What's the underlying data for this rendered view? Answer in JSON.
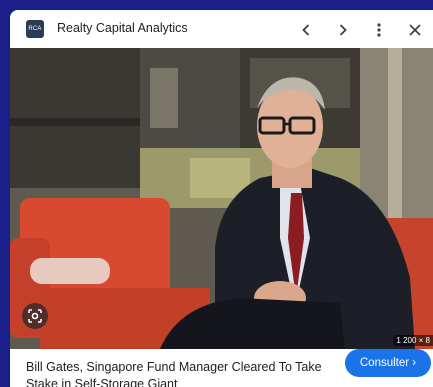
{
  "header": {
    "logo_text": "RCA",
    "title": "Realty Capital Analytics",
    "prev_icon": "chevron-left-icon",
    "next_icon": "chevron-right-icon",
    "menu_icon": "more-vert-icon",
    "close_icon": "close-icon"
  },
  "image": {
    "size_label": "1 200 × 8",
    "lens_icon": "lens-search-icon"
  },
  "footer": {
    "caption": "Bill Gates, Singapore Fund Manager Cleared To Take Stake in Self-Storage Giant",
    "action_label": "Consulter ›"
  },
  "colors": {
    "page_bg": "#1a1f8a",
    "accent": "#1a73e8",
    "chair": "#d9492f"
  }
}
